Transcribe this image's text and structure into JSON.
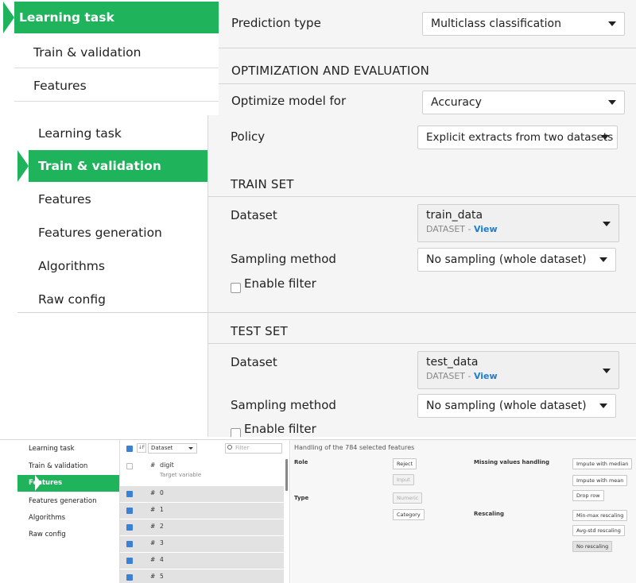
{
  "top_panel": {
    "nav": [
      "Learning task",
      "Train & validation",
      "Features"
    ],
    "prediction_type_label": "Prediction type",
    "prediction_type_value": "Multiclass classification",
    "optimization_heading": "OPTIMIZATION AND EVALUATION",
    "optimize_label": "Optimize model for",
    "optimize_value": "Accuracy"
  },
  "mid_panel": {
    "nav": [
      "Learning task",
      "Train & validation",
      "Features",
      "Features generation",
      "Algorithms",
      "Raw config"
    ],
    "policy_label": "Policy",
    "policy_value": "Explicit extracts from two datasets",
    "train_heading": "TRAIN SET",
    "train_dataset_label": "Dataset",
    "train_dataset_name": "train_data",
    "dataset_meta": "DATASET - ",
    "view_link": "View",
    "train_sampling_label": "Sampling method",
    "train_sampling_value": "No sampling (whole dataset)",
    "enable_filter": "Enable filter",
    "test_heading": "TEST SET",
    "test_dataset_label": "Dataset",
    "test_dataset_name": "test_data",
    "test_sampling_label": "Sampling method",
    "test_sampling_value": "No sampling (whole dataset)"
  },
  "bottom_panel": {
    "nav": [
      "Learning task",
      "Train & validation",
      "Features",
      "Features generation",
      "Algorithms",
      "Raw config"
    ],
    "dataset_select": "Dataset",
    "filter_placeholder": "Filter",
    "sort_icon_text": "↓F",
    "target": {
      "name": "digit",
      "note": "Target variable"
    },
    "rows": [
      "0",
      "1",
      "2",
      "3",
      "4",
      "5"
    ],
    "hash": "#",
    "handling_title": "Handling of the 784 selected features",
    "role_label": "Role",
    "type_label": "Type",
    "role_buttons": [
      "Reject",
      "Input"
    ],
    "type_buttons": [
      "Numeric",
      "Category"
    ],
    "missing_label": "Missing values handling",
    "missing_buttons": [
      "Impute with median",
      "Impute with mean",
      "Drop row"
    ],
    "rescaling_label": "Rescaling",
    "rescaling_buttons": [
      "Min-max rescaling",
      "Avg-std rescaling",
      "No rescaling"
    ]
  },
  "colors": {
    "accent": "#1fb35b",
    "link": "#1b7ed3"
  }
}
